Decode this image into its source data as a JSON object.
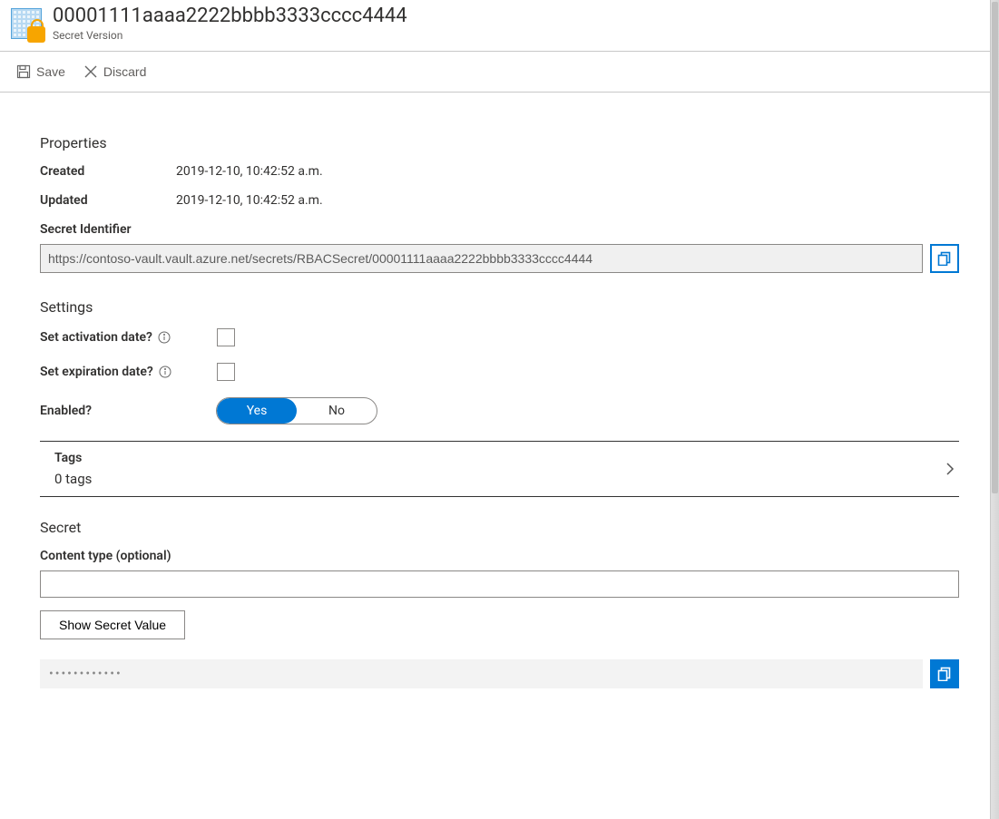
{
  "header": {
    "title": "00001111aaaa2222bbbb3333cccc4444",
    "subtitle": "Secret Version"
  },
  "toolbar": {
    "save": "Save",
    "discard": "Discard"
  },
  "properties": {
    "section": "Properties",
    "created_label": "Created",
    "created_value": "2019-12-10, 10:42:52 a.m.",
    "updated_label": "Updated",
    "updated_value": "2019-12-10, 10:42:52 a.m.",
    "identifier_label": "Secret Identifier",
    "identifier_value": "https://contoso-vault.vault.azure.net/secrets/RBACSecret/00001111aaaa2222bbbb3333cccc4444"
  },
  "settings": {
    "section": "Settings",
    "activation_label": "Set activation date?",
    "expiration_label": "Set expiration date?",
    "enabled_label": "Enabled?",
    "yes": "Yes",
    "no": "No"
  },
  "tags": {
    "title": "Tags",
    "count": "0 tags"
  },
  "secret": {
    "section": "Secret",
    "content_type_label": "Content type (optional)",
    "content_type_value": "",
    "show_button": "Show Secret Value",
    "masked": "••••••••••••"
  }
}
